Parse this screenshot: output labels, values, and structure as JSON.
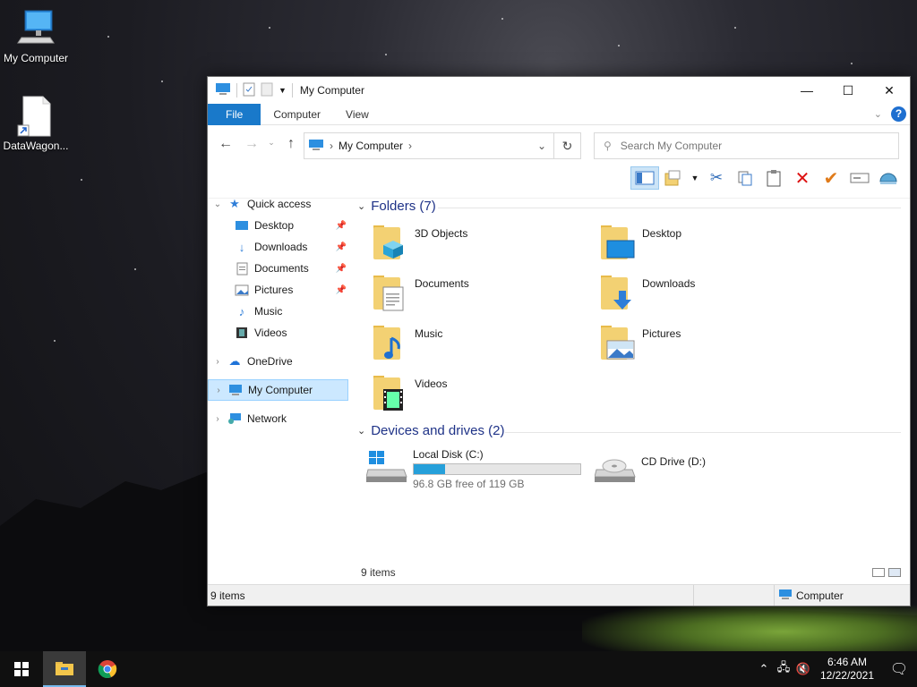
{
  "desktop": {
    "icons": [
      {
        "label": "My Computer",
        "icon": "computer-icon"
      },
      {
        "label": "DataWagon...",
        "icon": "file-shortcut-icon"
      }
    ]
  },
  "window": {
    "title": "My Computer",
    "ribbon": {
      "tabs": [
        "File",
        "Computer",
        "View"
      ]
    },
    "help_label": "?",
    "address": {
      "path_root_icon": "computer-icon",
      "path": "My Computer",
      "separator": "›",
      "search_placeholder": "Search My Computer"
    },
    "navpane": {
      "quick_access": "Quick access",
      "quick_items": [
        {
          "label": "Desktop",
          "icon": "desktop-icon",
          "pinned": true
        },
        {
          "label": "Downloads",
          "icon": "downloads-icon",
          "pinned": true
        },
        {
          "label": "Documents",
          "icon": "documents-icon",
          "pinned": true
        },
        {
          "label": "Pictures",
          "icon": "pictures-icon",
          "pinned": true
        },
        {
          "label": "Music",
          "icon": "music-icon",
          "pinned": false
        },
        {
          "label": "Videos",
          "icon": "videos-icon",
          "pinned": false
        }
      ],
      "onedrive": "OneDrive",
      "my_computer": "My Computer",
      "network": "Network"
    },
    "groups": {
      "folders_header": "Folders (7)",
      "devices_header": "Devices and drives (2)"
    },
    "folders": [
      {
        "name": "3D Objects",
        "icon": "3d-objects-icon"
      },
      {
        "name": "Desktop",
        "icon": "desktop-icon"
      },
      {
        "name": "Documents",
        "icon": "documents-icon"
      },
      {
        "name": "Downloads",
        "icon": "downloads-icon"
      },
      {
        "name": "Music",
        "icon": "music-icon"
      },
      {
        "name": "Pictures",
        "icon": "pictures-icon"
      },
      {
        "name": "Videos",
        "icon": "videos-icon"
      }
    ],
    "drives": [
      {
        "name": "Local Disk (C:)",
        "free": "96.8 GB free of 119 GB",
        "used_fraction": 0.19,
        "icon": "hard-drive-icon"
      },
      {
        "name": "CD Drive (D:)",
        "icon": "cd-drive-icon"
      }
    ],
    "inner_status": "9 items",
    "statusbar": {
      "items": "9 items",
      "location": "Computer"
    }
  },
  "taskbar": {
    "time": "6:46 AM",
    "date": "12/22/2021"
  },
  "colors": {
    "accent": "#1979ca",
    "progress": "#26a0da",
    "group_header": "#1e3287",
    "selection": "#cce8ff"
  }
}
